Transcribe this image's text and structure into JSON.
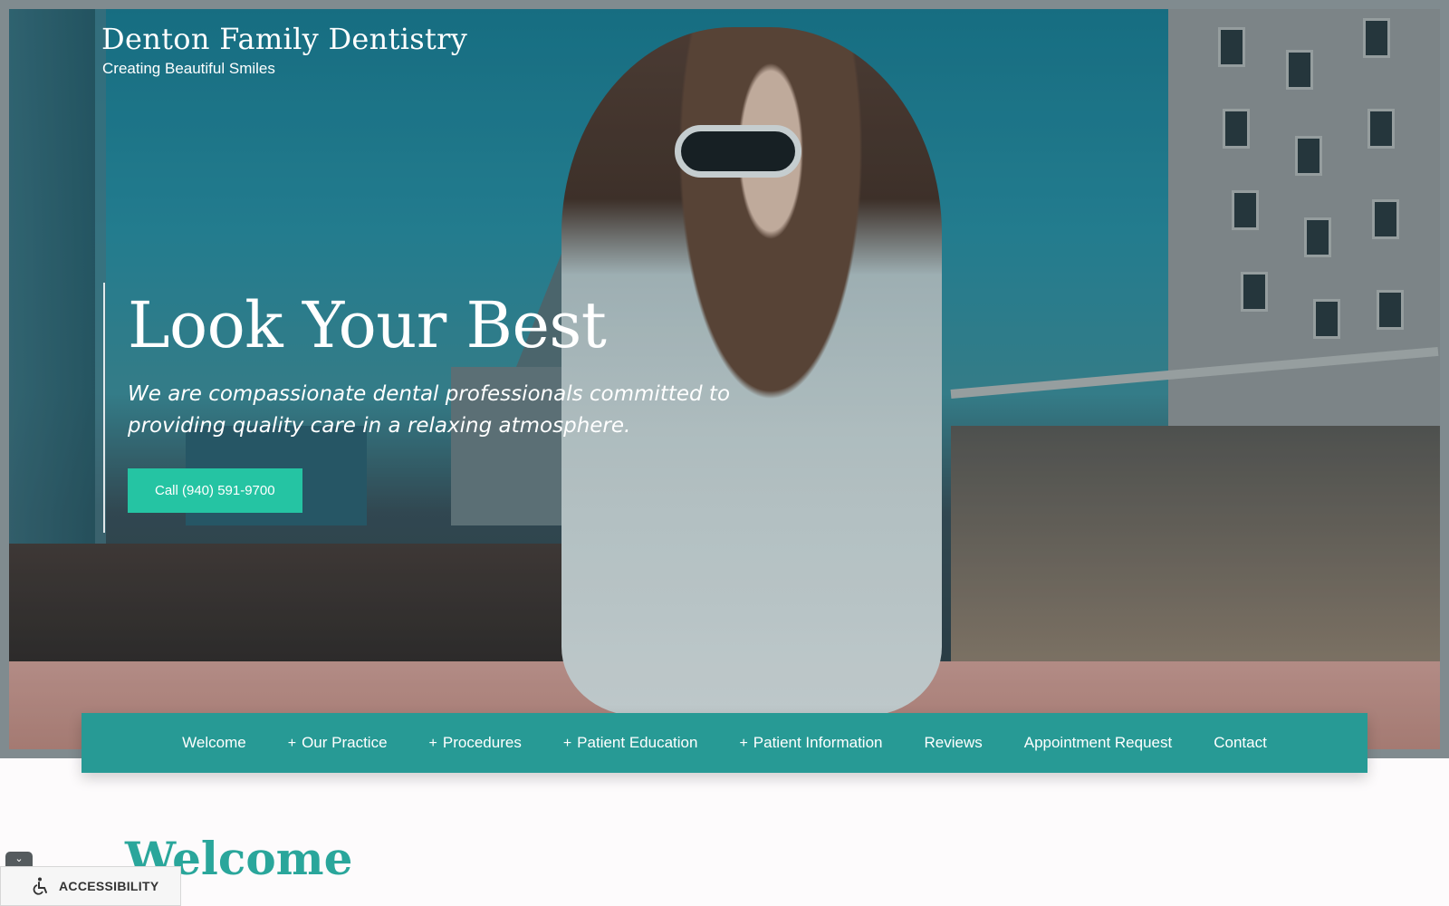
{
  "brand": {
    "title": "Denton Family Dentistry",
    "tagline": "Creating Beautiful Smiles"
  },
  "hero": {
    "heading": "Look Your Best",
    "subheading": "We are compassionate dental professionals committed to providing quality care in a relaxing atmosphere.",
    "cta_label": "Call (940) 591-9700"
  },
  "nav": {
    "items": [
      {
        "label": "Welcome",
        "has_submenu": false
      },
      {
        "label": "Our Practice",
        "has_submenu": true
      },
      {
        "label": "Procedures",
        "has_submenu": true
      },
      {
        "label": "Patient Education",
        "has_submenu": true
      },
      {
        "label": "Patient Information",
        "has_submenu": true
      },
      {
        "label": "Reviews",
        "has_submenu": false
      },
      {
        "label": "Appointment Request",
        "has_submenu": false
      },
      {
        "label": "Contact",
        "has_submenu": false
      }
    ],
    "submenu_marker": "+"
  },
  "main": {
    "heading": "Welcome"
  },
  "accessibility": {
    "label": "ACCESSIBILITY",
    "toggle_glyph": "⌄",
    "icon": "wheelchair-icon"
  },
  "colors": {
    "accent": "#279a95",
    "cta": "#25c4a3",
    "heading_teal": "#2aa69b"
  }
}
